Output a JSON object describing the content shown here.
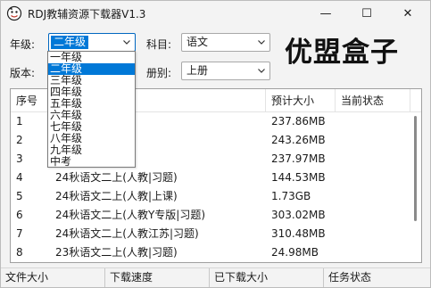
{
  "window": {
    "title": "RDJ教辅资源下载器V1.3",
    "minimize_glyph": "—",
    "maximize_glyph": "☐",
    "close_glyph": "✕",
    "icon": "app-mascot-icon"
  },
  "filters": {
    "grade_label": "年级:",
    "grade_value": "二年级",
    "subject_label": "科目:",
    "subject_value": "语文",
    "version_label": "版本:",
    "volume_label": "册别:",
    "volume_value": "上册"
  },
  "brand": {
    "text": "优盟盒子"
  },
  "grade_dropdown": {
    "options": [
      "一年级",
      "二年级",
      "三年级",
      "四年级",
      "五年级",
      "六年级",
      "七年级",
      "八年级",
      "九年级",
      "中考"
    ],
    "selected_index": 1
  },
  "table": {
    "columns": [
      "序号",
      "",
      "预计大小",
      "当前状态"
    ],
    "rows": [
      {
        "index": "1",
        "name": "教五四|习题)",
        "size": "237.86MB",
        "status": ""
      },
      {
        "index": "2",
        "name": "教浙江|习题)",
        "size": "243.26MB",
        "status": ""
      },
      {
        "index": "3",
        "name": "教|习题)",
        "size": "237.97MB",
        "status": ""
      },
      {
        "index": "4",
        "name": "24秋语文二上(人教|习题)",
        "size": "144.53MB",
        "status": ""
      },
      {
        "index": "5",
        "name": "24秋语文二上(人教|上课)",
        "size": "1.73GB",
        "status": ""
      },
      {
        "index": "6",
        "name": "24秋语文二上(人教Y专版|习题)",
        "size": "303.02MB",
        "status": ""
      },
      {
        "index": "7",
        "name": "24秋语文二上(人教江苏|习题)",
        "size": "310.48MB",
        "status": ""
      },
      {
        "index": "8",
        "name": "23秋语文二上(人教|习题)",
        "size": "24.98MB",
        "status": ""
      }
    ]
  },
  "statusbar": {
    "file_size": "文件大小",
    "speed": "下载速度",
    "downloaded": "已下载大小",
    "task_status": "任务状态"
  },
  "colors": {
    "accent": "#0078d7",
    "window_bg": "#f3f3f3",
    "table_bg": "#ffffff"
  }
}
